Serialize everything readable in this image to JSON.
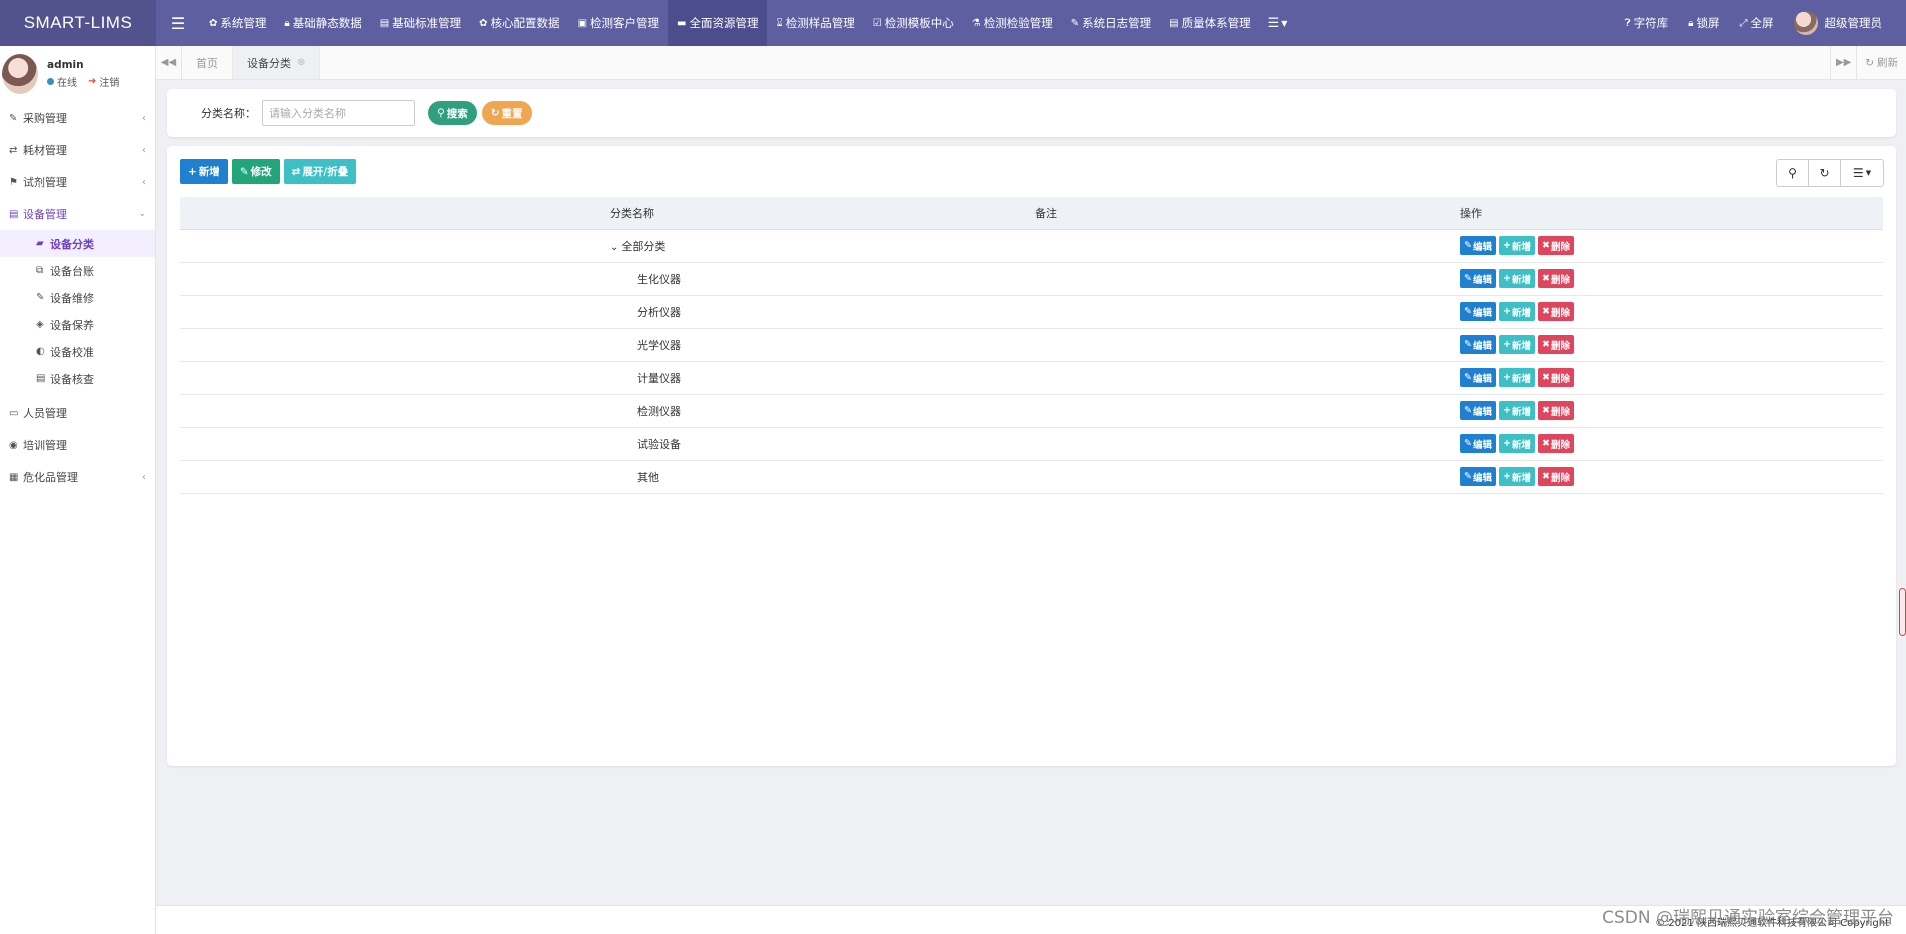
{
  "brand": "SMART-LIMS",
  "topnav": [
    {
      "icon": "✿",
      "label": "系统管理",
      "active": false
    },
    {
      "icon": "🔒︎",
      "label": "基础静态数据",
      "active": false
    },
    {
      "icon": "▤",
      "label": "基础标准管理",
      "active": false
    },
    {
      "icon": "✿",
      "label": "核心配置数据",
      "active": false
    },
    {
      "icon": "▣",
      "label": "检测客户管理",
      "active": false
    },
    {
      "icon": "▬",
      "label": "全面资源管理",
      "active": true
    },
    {
      "icon": "⌛︎",
      "label": "检测样品管理",
      "active": false
    },
    {
      "icon": "☑",
      "label": "检测模板中心",
      "active": false
    },
    {
      "icon": "⚗︎",
      "label": "检测检验管理",
      "active": false
    },
    {
      "icon": "✎",
      "label": "系统日志管理",
      "active": false
    },
    {
      "icon": "▤",
      "label": "质量体系管理",
      "active": false
    }
  ],
  "topright": {
    "dict": "字符库",
    "lock": "锁屏",
    "fullscreen": "全屏",
    "user": "超级管理员"
  },
  "user": {
    "name": "admin",
    "status": "在线",
    "logout": "注销"
  },
  "menu": {
    "purchase": "采购管理",
    "consumables": "耗材管理",
    "reagents": "试剂管理",
    "equipment": "设备管理",
    "sub": [
      {
        "label": "设备分类",
        "icon": "▰",
        "active": true
      },
      {
        "label": "设备台账",
        "icon": "⧉",
        "active": false
      },
      {
        "label": "设备维修",
        "icon": "✎",
        "active": false
      },
      {
        "label": "设备保养",
        "icon": "◈",
        "active": false
      },
      {
        "label": "设备校准",
        "icon": "◐",
        "active": false
      },
      {
        "label": "设备核查",
        "icon": "▤",
        "active": false
      }
    ],
    "personnel": "人员管理",
    "training": "培训管理",
    "hazmat": "危化品管理"
  },
  "tabs": {
    "home": "首页",
    "current": "设备分类",
    "refresh": "刷新"
  },
  "search": {
    "label": "分类名称：",
    "placeholder": "请输入分类名称",
    "search_btn": "搜索",
    "reset_btn": "重置"
  },
  "toolbar": {
    "add": "新增",
    "edit": "修改",
    "toggle": "展开/折叠"
  },
  "table": {
    "headers": {
      "name": "分类名称",
      "note": "备注",
      "ops": "操作"
    },
    "op_labels": {
      "edit": "编辑",
      "add": "新增",
      "del": "删除"
    },
    "rows": [
      {
        "name": "全部分类",
        "note": "",
        "root": true
      },
      {
        "name": "生化仪器",
        "note": "",
        "root": false
      },
      {
        "name": "分析仪器",
        "note": "",
        "root": false
      },
      {
        "name": "光学仪器",
        "note": "",
        "root": false
      },
      {
        "name": "计量仪器",
        "note": "",
        "root": false
      },
      {
        "name": "检测仪器",
        "note": "",
        "root": false
      },
      {
        "name": "试验设备",
        "note": "",
        "root": false
      },
      {
        "name": "其他",
        "note": "",
        "root": false
      }
    ]
  },
  "footer": {
    "copyright": "© 2021 陕西瑞熙贝通软件科技有限公司 Copyright",
    "watermark": "CSDN @瑞熙贝通实验室综合管理平台"
  },
  "colors": {
    "topbar": "#5e5fa0",
    "accent": "#6f42c1",
    "primary": "#1f7fd0",
    "success": "#22a57a",
    "info": "#3dbfc6",
    "danger": "#e0455e",
    "warning": "#f0a550"
  }
}
